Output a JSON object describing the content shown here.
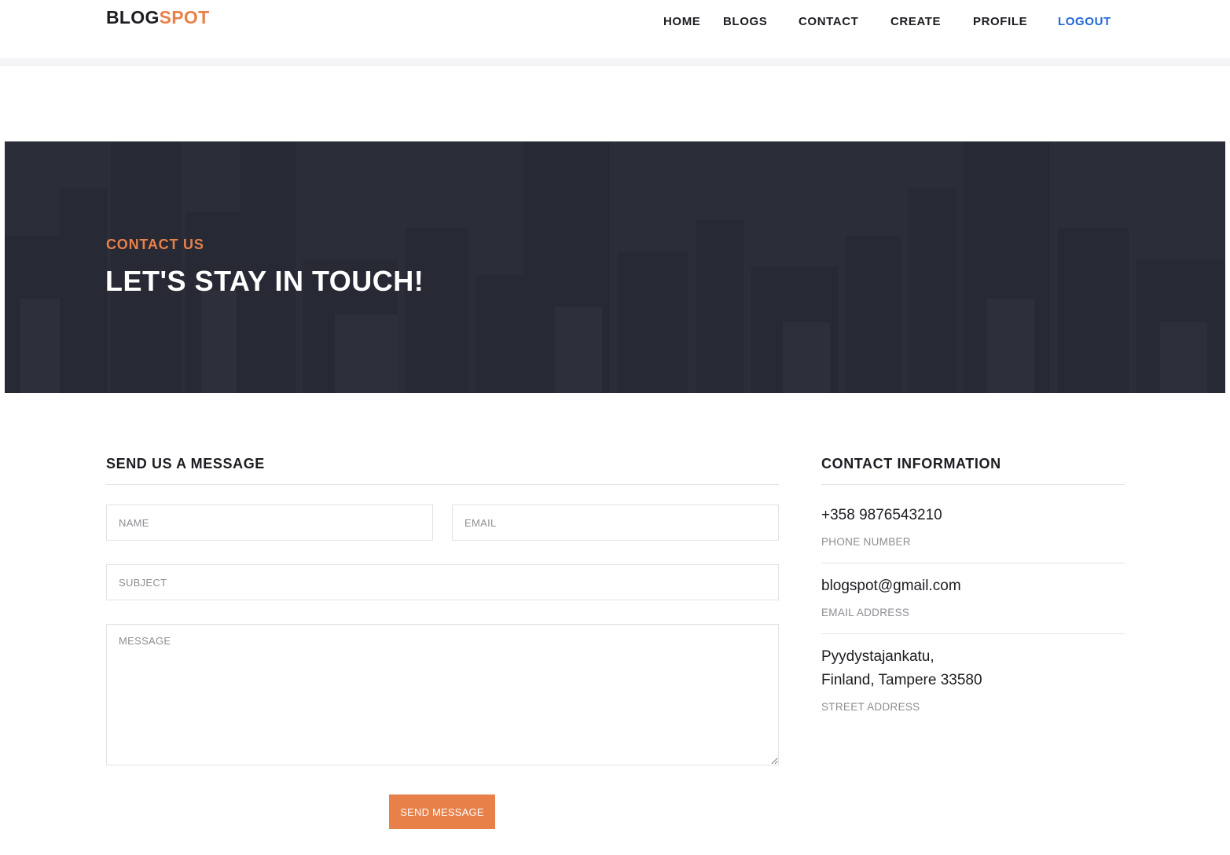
{
  "brand": {
    "part1": "BLOG",
    "part2": "SPOT"
  },
  "nav": {
    "items": [
      "HOME",
      "BLOGS",
      "CONTACT",
      "CREATE",
      "PROFILE"
    ],
    "logout": "LOGOUT"
  },
  "hero": {
    "eyebrow": "CONTACT US",
    "title": "LET'S STAY IN TOUCH!"
  },
  "form": {
    "heading": "SEND US A MESSAGE",
    "name_placeholder": "NAME",
    "email_placeholder": "EMAIL",
    "subject_placeholder": "SUBJECT",
    "message_placeholder": "MESSAGE",
    "submit_label": "SEND MESSAGE"
  },
  "contact_info": {
    "heading": "CONTACT INFORMATION",
    "phone": {
      "value": "+358 9876543210",
      "label": "PHONE NUMBER"
    },
    "email": {
      "value": "blogspot@gmail.com",
      "label": "EMAIL ADDRESS"
    },
    "address": {
      "line1": "Pyydystajankatu,",
      "line2": "Finland, Tampere 33580",
      "label": "STREET ADDRESS"
    }
  },
  "colors": {
    "accent": "#e8804a",
    "active_nav": "#1f68d6",
    "hero_bg": "#2f313c",
    "text": "#1c1d22"
  }
}
